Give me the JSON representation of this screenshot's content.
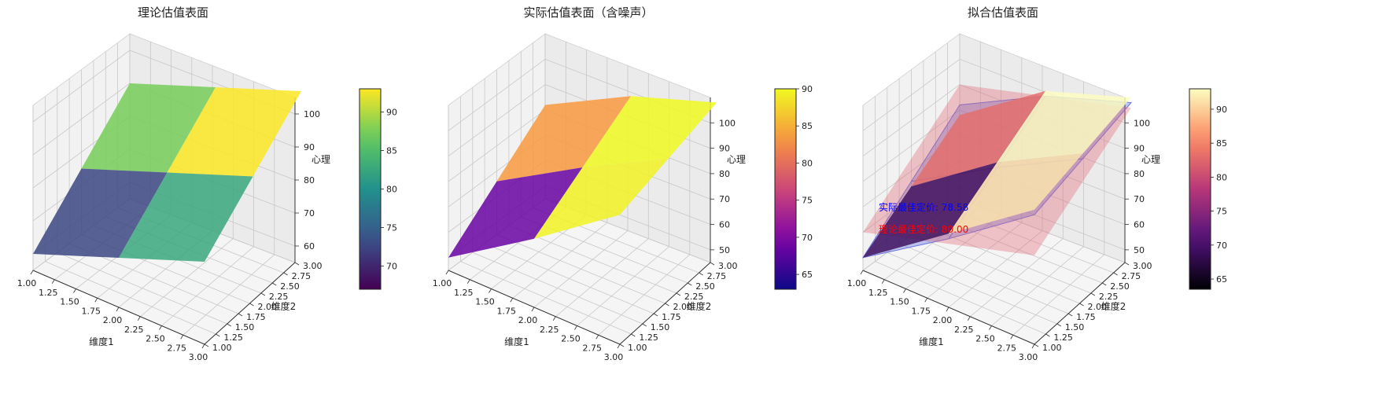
{
  "chart_data": [
    {
      "type": "surface",
      "title": "理论估值表面",
      "xlabel": "维度1",
      "ylabel": "维度2",
      "zlabel": "心理",
      "xticks": [
        "1.00",
        "1.25",
        "1.50",
        "1.75",
        "2.00",
        "2.25",
        "2.50",
        "2.75",
        "3.00"
      ],
      "yticks": [
        "1.00",
        "1.25",
        "1.50",
        "1.75",
        "2.00",
        "2.25",
        "2.50",
        "2.75",
        "3.00"
      ],
      "zticks": [
        "60",
        "70",
        "80",
        "90",
        "100"
      ],
      "zlim": [
        55,
        105
      ],
      "x": [
        1,
        2,
        3
      ],
      "y": [
        1,
        2,
        3
      ],
      "z": [
        [
          60,
          75,
          90
        ],
        [
          70,
          85,
          100
        ],
        [
          80,
          95,
          110
        ]
      ],
      "colormap": "viridis",
      "colorbar": {
        "ticks": [
          "70",
          "75",
          "80",
          "85",
          "90"
        ],
        "min": 67,
        "max": 93
      }
    },
    {
      "type": "surface",
      "title": "实际估值表面（含噪声）",
      "xlabel": "维度1",
      "ylabel": "维度2",
      "zlabel": "心理",
      "xticks": [
        "1.00",
        "1.25",
        "1.50",
        "1.75",
        "2.00",
        "2.25",
        "2.50",
        "2.75",
        "3.00"
      ],
      "yticks": [
        "1.00",
        "1.25",
        "1.50",
        "1.75",
        "2.00",
        "2.25",
        "2.50",
        "2.75",
        "3.00"
      ],
      "zticks": [
        "50",
        "60",
        "70",
        "80",
        "90",
        "100"
      ],
      "zlim": [
        45,
        110
      ],
      "x": [
        1,
        2,
        3
      ],
      "y": [
        1,
        2,
        3
      ],
      "z": [
        [
          50,
          66,
          82
        ],
        [
          72,
          86,
          100
        ],
        [
          96,
          104,
          112
        ]
      ],
      "colormap": "plasma",
      "colorbar": {
        "ticks": [
          "65",
          "70",
          "75",
          "80",
          "85",
          "90"
        ],
        "min": 63,
        "max": 90
      }
    },
    {
      "type": "surface",
      "title": "拟合估值表面",
      "xlabel": "维度1",
      "ylabel": "维度2",
      "zlabel": "心理",
      "xticks": [
        "1.00",
        "1.25",
        "1.50",
        "1.75",
        "2.00",
        "2.25",
        "2.50",
        "2.75",
        "3.00"
      ],
      "yticks": [
        "1.00",
        "1.25",
        "1.50",
        "1.75",
        "2.00",
        "2.25",
        "2.50",
        "2.75",
        "3.00"
      ],
      "zticks": [
        "50",
        "60",
        "70",
        "80",
        "90",
        "100"
      ],
      "zlim": [
        45,
        110
      ],
      "x": [
        1,
        2,
        3
      ],
      "y": [
        1,
        2,
        3
      ],
      "z": [
        [
          50,
          64,
          78
        ],
        [
          74,
          88,
          102
        ],
        [
          98,
          106,
          114
        ]
      ],
      "colormap": "magma",
      "colorbar": {
        "ticks": [
          "65",
          "70",
          "75",
          "80",
          "85",
          "90"
        ],
        "min": 63.5,
        "max": 93
      }
    }
  ],
  "annotations": {
    "actual_optimal": "实际最佳定价: 78.58",
    "theory_optimal": "理论最佳定价: 80.00",
    "actual_color": "#0000ff",
    "theory_color": "#ff0000"
  }
}
